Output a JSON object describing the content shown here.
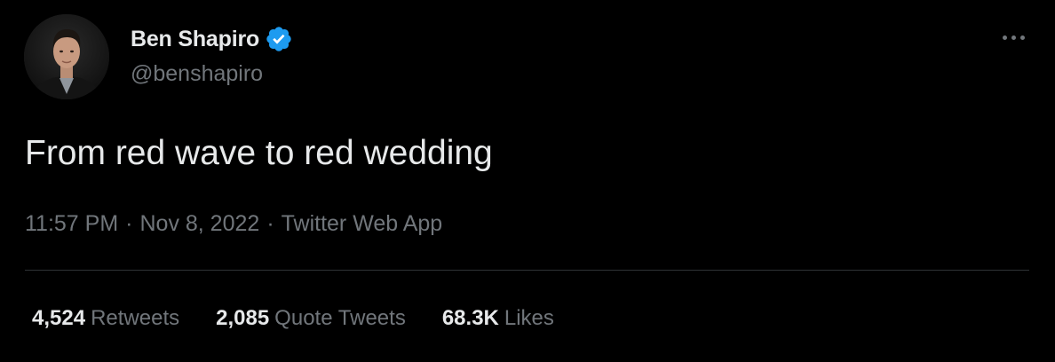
{
  "author": {
    "display_name": "Ben Shapiro",
    "handle": "@benshapiro",
    "verified_icon": "verified-badge-icon",
    "avatar_icon": "profile-photo"
  },
  "tweet": {
    "text": "From red wave to red wedding",
    "time": "11:57 PM",
    "separator": "·",
    "date": "Nov 8, 2022",
    "source": "Twitter Web App"
  },
  "stats": {
    "retweets_count": "4,524",
    "retweets_label": "Retweets",
    "quotes_count": "2,085",
    "quotes_label": "Quote Tweets",
    "likes_count": "68.3K",
    "likes_label": "Likes"
  },
  "colors": {
    "background": "#000000",
    "primary_text": "#e7e9ea",
    "secondary_text": "#71767b",
    "verified_blue": "#1d9bf0",
    "divider": "#2f3336"
  }
}
